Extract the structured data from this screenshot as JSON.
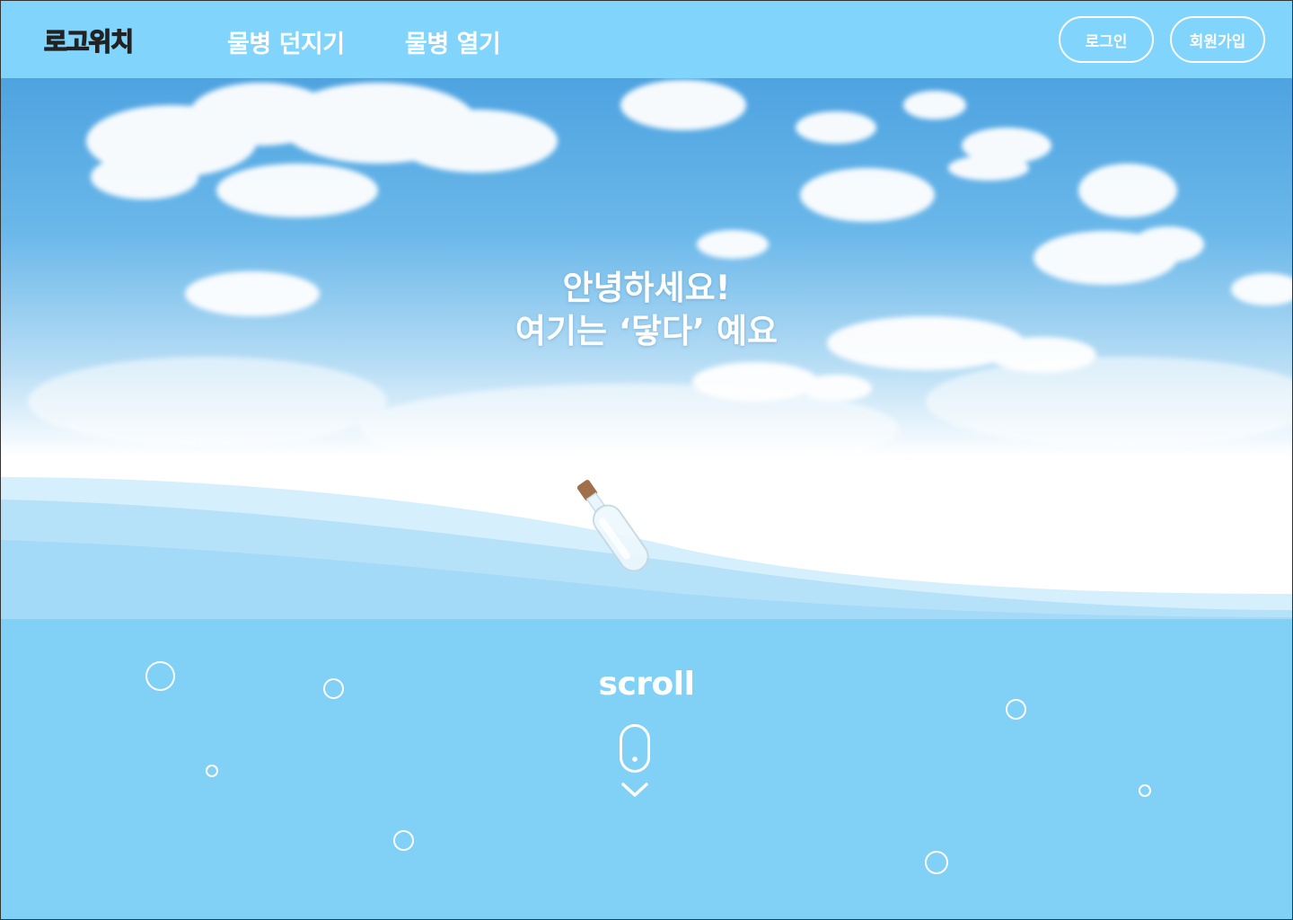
{
  "header": {
    "logo": "로고위치",
    "nav": [
      {
        "label": "물병 던지기"
      },
      {
        "label": "물병 열기"
      }
    ],
    "login_label": "로그인",
    "signup_label": "회원가입"
  },
  "hero": {
    "line1": "안녕하세요!",
    "line2": "여기는 ‘닿다’ 예요"
  },
  "scroll": {
    "label": "scroll",
    "icon": "mouse-scroll-icon"
  },
  "colors": {
    "header_bg": "#81d4fb",
    "sea_bg": "#81d1f7",
    "sky_top": "#4ea3e0",
    "text": "#ffffff"
  }
}
